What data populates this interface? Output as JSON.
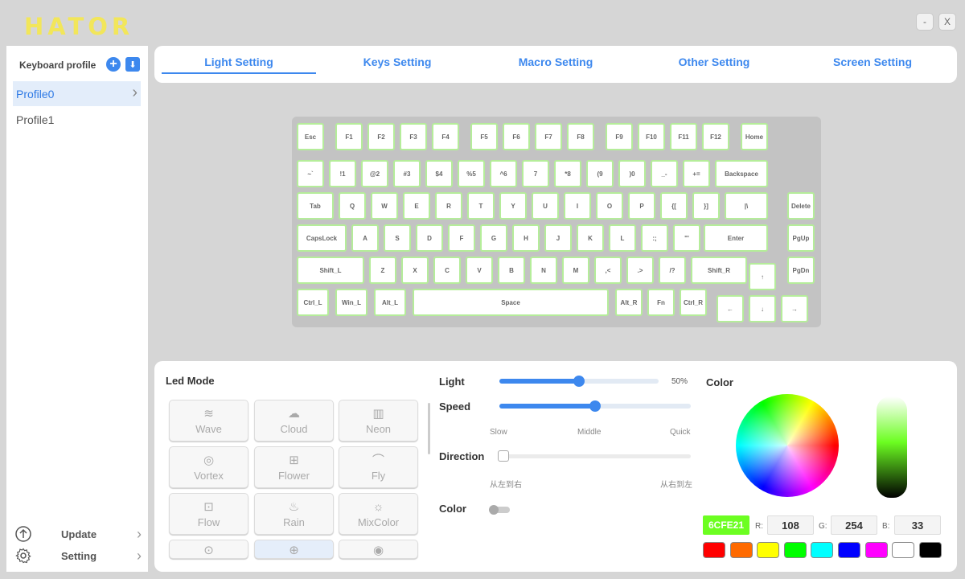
{
  "app": {
    "logo": "HATOR",
    "minimize": "-",
    "close": "X"
  },
  "sidebar": {
    "profile_title": "Keyboard profile",
    "profiles": [
      "Profile0",
      "Profile1"
    ],
    "update_label": "Update",
    "setting_label": "Setting"
  },
  "tabs": [
    "Light Setting",
    "Keys Setting",
    "Macro Setting",
    "Other Setting",
    "Screen Setting"
  ],
  "keyboard": {
    "keys": [
      {
        "t": "Esc"
      },
      {
        "t": "F1"
      },
      {
        "t": "F2"
      },
      {
        "t": "F3"
      },
      {
        "t": "F4"
      },
      {
        "t": "F5"
      },
      {
        "t": "F6"
      },
      {
        "t": "F7"
      },
      {
        "t": "F8"
      },
      {
        "t": "F9"
      },
      {
        "t": "F10"
      },
      {
        "t": "F11"
      },
      {
        "t": "F12"
      },
      {
        "t": "Home"
      },
      {
        "t": "~`"
      },
      {
        "t": "!1"
      },
      {
        "t": "@2"
      },
      {
        "t": "#3"
      },
      {
        "t": "$4"
      },
      {
        "t": "%5"
      },
      {
        "t": "^6"
      },
      {
        "t": "7"
      },
      {
        "t": "*8"
      },
      {
        "t": "(9"
      },
      {
        "t": ")0"
      },
      {
        "t": "_-"
      },
      {
        "t": "+="
      },
      {
        "t": "Backspace"
      },
      {
        "t": "Tab"
      },
      {
        "t": "Q"
      },
      {
        "t": "W"
      },
      {
        "t": "E"
      },
      {
        "t": "R"
      },
      {
        "t": "T"
      },
      {
        "t": "Y"
      },
      {
        "t": "U"
      },
      {
        "t": "I"
      },
      {
        "t": "O"
      },
      {
        "t": "P"
      },
      {
        "t": "{["
      },
      {
        "t": "}]"
      },
      {
        "t": "|\\"
      },
      {
        "t": "Delete"
      },
      {
        "t": "CapsLock"
      },
      {
        "t": "A"
      },
      {
        "t": "S"
      },
      {
        "t": "D"
      },
      {
        "t": "F"
      },
      {
        "t": "G"
      },
      {
        "t": "H"
      },
      {
        "t": "J"
      },
      {
        "t": "K"
      },
      {
        "t": "L"
      },
      {
        "t": ":;"
      },
      {
        "t": "\"'"
      },
      {
        "t": "Enter"
      },
      {
        "t": "PgUp"
      },
      {
        "t": "Shift_L"
      },
      {
        "t": "Z"
      },
      {
        "t": "X"
      },
      {
        "t": "C"
      },
      {
        "t": "V"
      },
      {
        "t": "B"
      },
      {
        "t": "N"
      },
      {
        "t": "M"
      },
      {
        "t": ",<"
      },
      {
        "t": ".>"
      },
      {
        "t": "/?"
      },
      {
        "t": "Shift_R"
      },
      {
        "t": "↑"
      },
      {
        "t": "PgDn"
      },
      {
        "t": "Ctrl_L"
      },
      {
        "t": "Win_L"
      },
      {
        "t": "Alt_L"
      },
      {
        "t": "Space"
      },
      {
        "t": "Alt_R"
      },
      {
        "t": "Fn"
      },
      {
        "t": "Ctrl_R"
      },
      {
        "t": "←"
      },
      {
        "t": "↓"
      },
      {
        "t": "→"
      }
    ]
  },
  "led": {
    "title": "Led Mode",
    "modes": [
      {
        "label": "Wave",
        "icon": "wave-icon",
        "glyph": "≋"
      },
      {
        "label": "Cloud",
        "icon": "cloud-icon",
        "glyph": "☁"
      },
      {
        "label": "Neon",
        "icon": "neon-icon",
        "glyph": "▥"
      },
      {
        "label": "Vortex",
        "icon": "vortex-icon",
        "glyph": "◎"
      },
      {
        "label": "Flower",
        "icon": "flower-icon",
        "glyph": "⊞"
      },
      {
        "label": "Fly",
        "icon": "fly-icon",
        "glyph": "⌒"
      },
      {
        "label": "Flow",
        "icon": "flow-icon",
        "glyph": "⊡"
      },
      {
        "label": "Rain",
        "icon": "rain-icon",
        "glyph": "♨"
      },
      {
        "label": "MixColor",
        "icon": "mixcolor-icon",
        "glyph": "☼"
      },
      {
        "label": "",
        "icon": "mode-10-icon",
        "glyph": "⊙"
      },
      {
        "label": "",
        "icon": "mode-11-icon",
        "glyph": "⊕"
      },
      {
        "label": "",
        "icon": "mode-12-icon",
        "glyph": "◉"
      }
    ],
    "active_index": 10
  },
  "controls": {
    "light_label": "Light",
    "light_value": "50%",
    "light_level": 0.5,
    "speed_label": "Speed",
    "speed_level": 0.5,
    "speed_slow": "Slow",
    "speed_middle": "Middle",
    "speed_quick": "Quick",
    "direction_label": "Direction",
    "direction_level": 0,
    "direction_left": "从左到右",
    "direction_right": "从右到左",
    "color_label": "Color",
    "color_toggle_on": false
  },
  "color": {
    "title": "Color",
    "hex": "6CFE21",
    "r_label": "R:",
    "r": "108",
    "g_label": "G:",
    "g": "254",
    "b_label": "B:",
    "b": "33",
    "swatches": [
      "#ff0000",
      "#ff6a00",
      "#ffff00",
      "#00ff00",
      "#00ffff",
      "#0000ff",
      "#ff00ff",
      "#ffffff",
      "#000000"
    ],
    "accent": "#3d88ee",
    "selected": "#6CFE21"
  }
}
